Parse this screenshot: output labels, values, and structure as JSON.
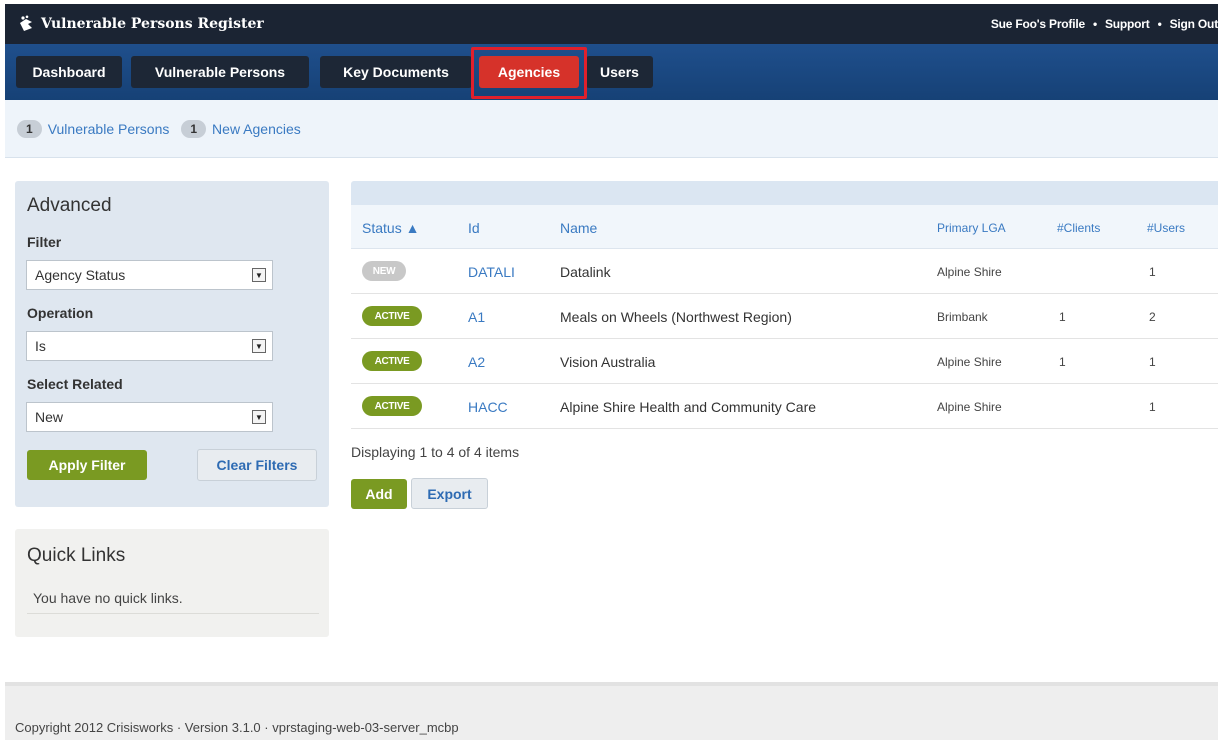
{
  "app": {
    "title": "Vulnerable Persons Register",
    "top_links": [
      "Sue Foo's Profile",
      "Support",
      "Sign Out"
    ],
    "link_separator": "•"
  },
  "nav": {
    "items": [
      "Dashboard",
      "Vulnerable Persons",
      "Key Documents",
      "Agencies",
      "Users"
    ],
    "active": "Agencies"
  },
  "subbar": {
    "pills": [
      {
        "count": "1",
        "label": "Vulnerable Persons"
      },
      {
        "count": "1",
        "label": "New Agencies"
      }
    ]
  },
  "advanced": {
    "title": "Advanced",
    "filter_label": "Filter",
    "filter_value": "Agency Status",
    "operation_label": "Operation",
    "operation_value": "Is",
    "related_label": "Select Related",
    "related_value": "New",
    "apply_label": "Apply Filter",
    "clear_label": "Clear Filters"
  },
  "quick_links": {
    "title": "Quick Links",
    "empty_text": "You have no quick links."
  },
  "table": {
    "headers": [
      "Status ▲",
      "Id",
      "Name",
      "Primary LGA",
      "#Clients",
      "#Users"
    ],
    "rows": [
      {
        "status": "NEW",
        "id": "DATALI",
        "name": "Datalink",
        "lga": "Alpine Shire",
        "clients": "",
        "users": "1"
      },
      {
        "status": "ACTIVE",
        "id": "A1",
        "name": "Meals on Wheels (Northwest Region)",
        "lga": "Brimbank",
        "clients": "1",
        "users": "2"
      },
      {
        "status": "ACTIVE",
        "id": "A2",
        "name": "Vision Australia",
        "lga": "Alpine Shire",
        "clients": "1",
        "users": "1"
      },
      {
        "status": "ACTIVE",
        "id": "HACC",
        "name": "Alpine Shire Health and Community Care",
        "lga": "Alpine Shire",
        "clients": "",
        "users": "1"
      }
    ],
    "displaying": "Displaying 1 to 4 of 4 items",
    "add_label": "Add",
    "export_label": "Export"
  },
  "footer": {
    "text": "Copyright 2012 Crisisworks  ·  Version 3.1.0  ·  vprstaging-web-03-server_mcbp"
  },
  "colors": {
    "topbar": "#1b2433",
    "nav": "#1f4f8c",
    "active_tab": "#d6322a",
    "green": "#7a9a22",
    "link": "#3a7ac2"
  }
}
